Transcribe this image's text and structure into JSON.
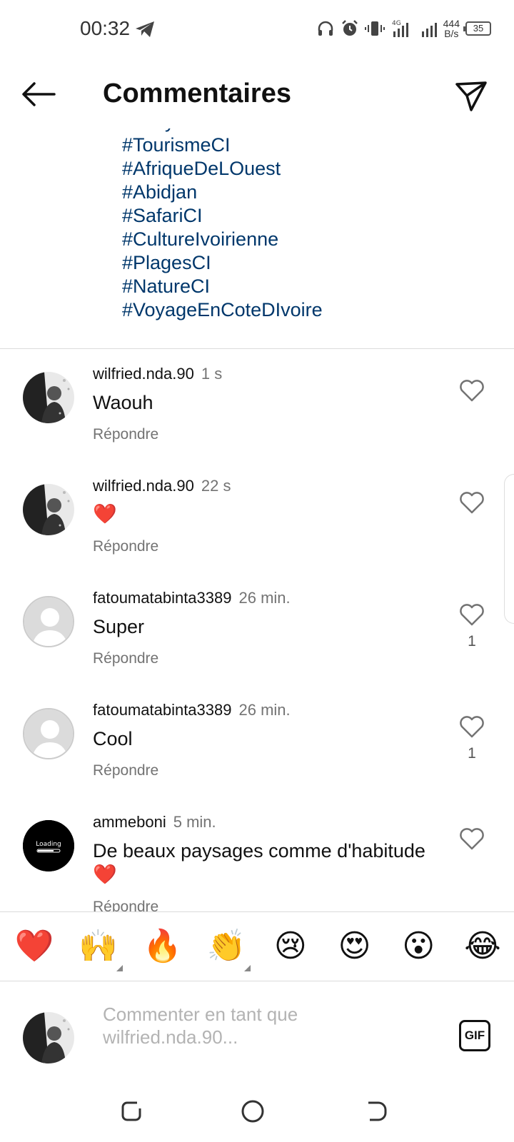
{
  "status_bar": {
    "time": "00:32",
    "net_speed_value": "444",
    "net_speed_unit": "B/s",
    "network": "4G",
    "battery": "35"
  },
  "header": {
    "title": "Commentaires"
  },
  "caption": {
    "hashtags": [
      "#IvoryCoast",
      "#TourismeCI",
      "#AfriqueDeLOuest",
      "#Abidjan",
      "#SafariCI",
      "#CultureIvoirienne",
      "#PlagesCI",
      "#NatureCI",
      "#VoyageEnCoteDIvoire"
    ]
  },
  "comments": [
    {
      "username": "wilfried.nda.90",
      "time": "1 s",
      "text": "Waouh",
      "reply_label": "Répondre",
      "likes": ""
    },
    {
      "username": "wilfried.nda.90",
      "time": "22 s",
      "text": "❤️",
      "reply_label": "Répondre",
      "likes": ""
    },
    {
      "username": "fatoumatabinta3389",
      "time": "26 min.",
      "text": "Super",
      "reply_label": "Répondre",
      "likes": "1"
    },
    {
      "username": "fatoumatabinta3389",
      "time": "26 min.",
      "text": "Cool",
      "reply_label": "Répondre",
      "likes": "1"
    },
    {
      "username": "ammeboni",
      "time": "5 min.",
      "text": "De beaux paysages comme d'habitude",
      "text2": "❤️",
      "reply_label": "Répondre",
      "likes": ""
    }
  ],
  "avatar_label_loading": "Loading",
  "emoji_bar": [
    "❤️",
    "🙌",
    "🔥",
    "👏",
    "😢",
    "😍",
    "😮",
    "😂"
  ],
  "composer": {
    "placeholder": "Commenter en tant que wilfried.nda.90...",
    "gif_label": "GIF"
  },
  "colors": {
    "hashtag": "#00376b",
    "secondary_text": "#737373",
    "divider": "#dbdbdb",
    "heart": "#e0245e"
  }
}
